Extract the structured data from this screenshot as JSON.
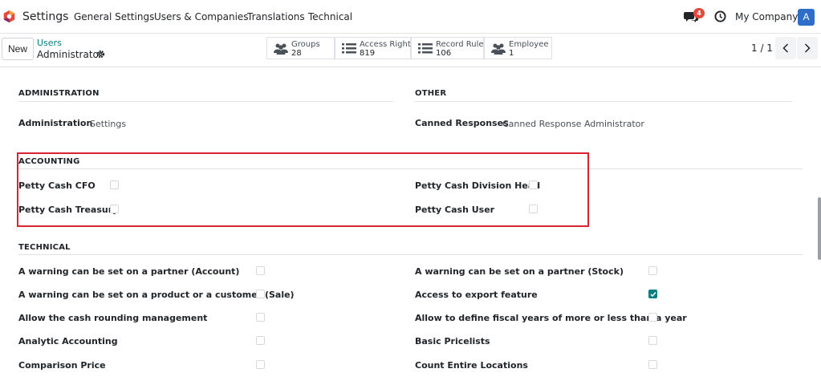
{
  "navbar": {
    "app_name": "Settings",
    "menu": [
      "General Settings",
      "Users & Companies",
      "Translations",
      "Technical"
    ],
    "notification_count": "4",
    "company": "My Company",
    "avatar_letter": "A",
    "logo_color": "#e04b3e"
  },
  "control_panel": {
    "new_label": "New",
    "breadcrumb_parent": "Users",
    "breadcrumb_current": "Administrator",
    "stats": [
      {
        "label": "Groups",
        "value": "28",
        "icon": "users-icon"
      },
      {
        "label": "Access Rights",
        "value": "819",
        "icon": "list-icon"
      },
      {
        "label": "Record Rules",
        "value": "106",
        "icon": "list-icon"
      },
      {
        "label": "Employee",
        "value": "1",
        "icon": "users-icon"
      }
    ],
    "pager": "1 / 1"
  },
  "sections": {
    "administration": {
      "title": "ADMINISTRATION",
      "fields": [
        {
          "label": "Administration",
          "value": "Settings"
        }
      ]
    },
    "other": {
      "title": "OTHER",
      "fields": [
        {
          "label": "Canned Responses",
          "value": "Canned Response Administrator"
        }
      ]
    },
    "accounting": {
      "title": "ACCOUNTING",
      "left": [
        {
          "label": "Petty Cash CFO",
          "checked": false
        },
        {
          "label": "Petty Cash Treasury",
          "checked": false
        }
      ],
      "right": [
        {
          "label": "Petty Cash Division Head",
          "checked": false
        },
        {
          "label": "Petty Cash User",
          "checked": false
        }
      ]
    },
    "technical": {
      "title": "TECHNICAL",
      "left": [
        {
          "label": "A warning can be set on a partner (Account)",
          "checked": false
        },
        {
          "label": "A warning can be set on a product or a customer (Sale)",
          "checked": false
        },
        {
          "label": "Allow the cash rounding management",
          "checked": false
        },
        {
          "label": "Analytic Accounting",
          "checked": false
        },
        {
          "label": "Comparison Price",
          "checked": false
        }
      ],
      "right": [
        {
          "label": "A warning can be set on a partner (Stock)",
          "checked": false
        },
        {
          "label": "Access to export feature",
          "checked": true
        },
        {
          "label": "Allow to define fiscal years of more or less than a year",
          "checked": false
        },
        {
          "label": "Basic Pricelists",
          "checked": false
        },
        {
          "label": "Count Entire Locations",
          "checked": false
        }
      ]
    }
  },
  "colors": {
    "accent": "#017e84",
    "highlight": "#d9232e",
    "avatar": "#2f6ec8"
  }
}
